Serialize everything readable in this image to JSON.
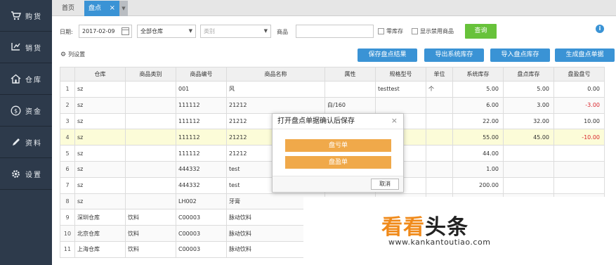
{
  "sidebar": {
    "items": [
      {
        "label": "购货",
        "icon": "cart-icon"
      },
      {
        "label": "销货",
        "icon": "cart-out-icon"
      },
      {
        "label": "仓库",
        "icon": "home-icon"
      },
      {
        "label": "资金",
        "icon": "money-icon"
      },
      {
        "label": "资料",
        "icon": "pencil-icon"
      },
      {
        "label": "设置",
        "icon": "gear-icon"
      }
    ]
  },
  "tabs": {
    "home": "首页",
    "active": "盘点",
    "close": "×",
    "dropdown": "▼"
  },
  "filter": {
    "date_label": "日期:",
    "date_value": "2017-02-09",
    "warehouse_value": "全部仓库",
    "category_placeholder": "类别",
    "goods_label": "商品",
    "zero_stock_label": "零库存",
    "show_disabled_label": "显示禁用商品",
    "query_label": "查询",
    "info": "i"
  },
  "toolbar": {
    "column_settings": "列设置",
    "buttons": [
      "保存盘点结果",
      "导出系统库存",
      "导入盘点库存",
      "生成盘点单据"
    ]
  },
  "table": {
    "headers": [
      "",
      "仓库",
      "商品类别",
      "商品编号",
      "商品名称",
      "属性",
      "规格型号",
      "单位",
      "系统库存",
      "盘点库存",
      "盘盈盘亏"
    ],
    "rows": [
      [
        "1",
        "sz",
        "",
        "001",
        "风",
        "",
        "testtest",
        "个",
        "5.00",
        "5.00",
        "0.00"
      ],
      [
        "2",
        "sz",
        "",
        "111112",
        "21212",
        "白/160",
        "",
        "",
        "6.00",
        "3.00",
        "-3.00"
      ],
      [
        "3",
        "sz",
        "",
        "111112",
        "21212",
        "",
        "",
        "",
        "22.00",
        "32.00",
        "10.00"
      ],
      [
        "4",
        "sz",
        "",
        "111112",
        "21212",
        "",
        "",
        "",
        "55.00",
        "45.00",
        "-10.00"
      ],
      [
        "5",
        "sz",
        "",
        "111112",
        "21212",
        "",
        "",
        "",
        "44.00",
        "",
        ""
      ],
      [
        "6",
        "sz",
        "",
        "444332",
        "test",
        "",
        "",
        "",
        "1.00",
        "",
        ""
      ],
      [
        "7",
        "sz",
        "",
        "444332",
        "test",
        "",
        "",
        "",
        "200.00",
        "",
        ""
      ],
      [
        "8",
        "sz",
        "",
        "LH002",
        "牙膏",
        "",
        "",
        "",
        "",
        "",
        ""
      ],
      [
        "9",
        "深圳仓库",
        "饮料",
        "C00003",
        "脉动饮料",
        "",
        "",
        "",
        "",
        "",
        ""
      ],
      [
        "10",
        "北京仓库",
        "饮料",
        "C00003",
        "脉动饮料",
        "",
        "",
        "",
        "",
        "",
        ""
      ],
      [
        "11",
        "上海仓库",
        "饮料",
        "C00003",
        "脉动饮料",
        "",
        "",
        "",
        "",
        "",
        ""
      ]
    ],
    "highlight_row": 3
  },
  "dialog": {
    "title": "打开盘点单据确认后保存",
    "close": "×",
    "btn_loss": "盘亏单",
    "btn_gain": "盘盈单",
    "cancel": "取消"
  },
  "watermark": {
    "logo_orange": "看看",
    "logo_black": "头条",
    "url": "www.kankantoutiao.com"
  },
  "colors": {
    "sidebar_bg": "#2d3a4b",
    "accent_blue": "#3a93d5",
    "query_green": "#67c23a",
    "dialog_orange": "#f0a94a",
    "negative_red": "#d9262c",
    "highlight_row": "#fcfcd8"
  }
}
